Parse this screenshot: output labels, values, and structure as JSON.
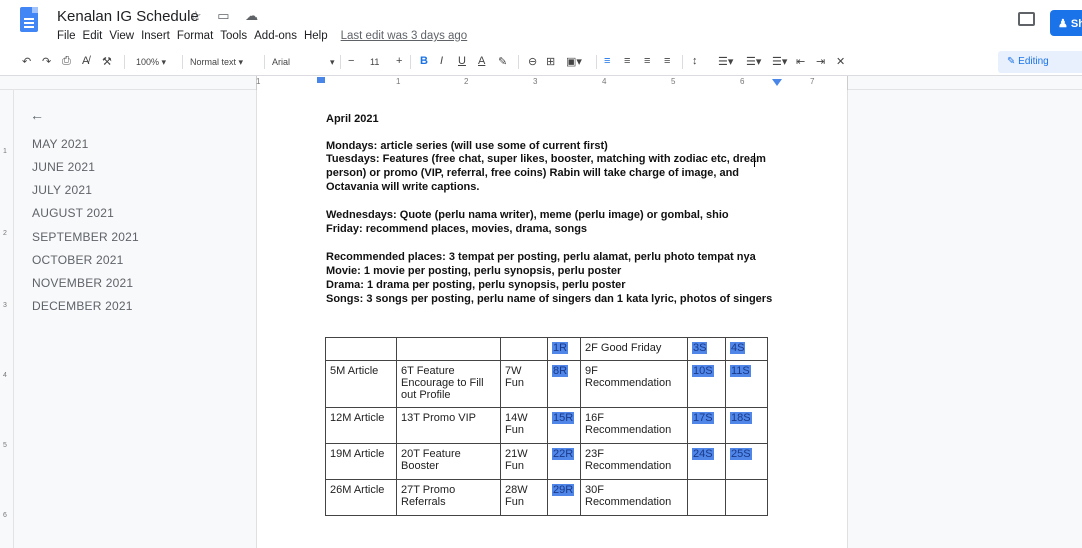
{
  "header": {
    "title": "Kenalan IG Schedule",
    "title_icons": "☆ ▭ ☁",
    "menu": [
      "File",
      "Edit",
      "View",
      "Insert",
      "Format",
      "Tools",
      "Add-ons",
      "Help"
    ],
    "last_edit": "Last edit was 3 days ago",
    "share_label": "Sh"
  },
  "toolbar": {
    "zoom": "100%",
    "style": "Normal text",
    "font": "Arial",
    "font_size": "11",
    "mode": "Editing"
  },
  "ruler": {
    "numbers": [
      "1",
      "1",
      "2",
      "3",
      "4",
      "5",
      "6",
      "7"
    ],
    "vertical_numbers": [
      "1",
      "2",
      "3",
      "4",
      "5",
      "6"
    ]
  },
  "outline": {
    "items": [
      "MAY 2021",
      "JUNE 2021",
      "JULY 2021",
      "AUGUST 2021",
      "SEPTEMBER 2021",
      "OCTOBER 2021",
      "NOVEMBER 2021",
      "DECEMBER 2021"
    ]
  },
  "document": {
    "lines": [
      "April 2021",
      "Mondays: article series (will use some of current first)",
      "Tuesdays: Features (free chat, super likes, booster, matching with zodiac etc, dream",
      "person)  or promo (VIP, referral, free coins) Rabin will take charge of image, and",
      "Octavania will write captions.",
      "Wednesdays: Quote (perlu nama writer), meme (perlu image) or gombal, shio",
      "Friday: recommend places, movies, drama, songs",
      "Recommended places: 3 tempat per posting, perlu alamat, perlu photo tempat nya",
      "Movie: 1 movie per posting, perlu synopsis, perlu poster",
      "Drama: 1 drama per posting, perlu synopsis, perlu poster",
      "Songs: 3 songs per posting, perlu name of singers dan 1 kata lyric, photos of singers"
    ]
  },
  "calendar": {
    "rows": [
      [
        "",
        "",
        "",
        "1R",
        "2F Good Friday",
        "3S",
        "4S"
      ],
      [
        "5M Article",
        "6T Feature Encourage to Fill out Profile",
        "7W Fun",
        "8R",
        "9F Recommendation",
        "10S",
        "11S"
      ],
      [
        "12M Article",
        "13T Promo VIP",
        "14W Fun",
        "15R",
        "16F Recommendation",
        "17S",
        "18S"
      ],
      [
        "19M Article",
        "20T Feature Booster",
        "21W Fun",
        "22R",
        "23F Recommendation",
        "24S",
        "25S"
      ],
      [
        "26M Article",
        "27T Promo Referrals",
        "28W Fun",
        "29R",
        "30F Recommendation",
        "",
        ""
      ]
    ],
    "highlight_color": "#4f86e8"
  }
}
